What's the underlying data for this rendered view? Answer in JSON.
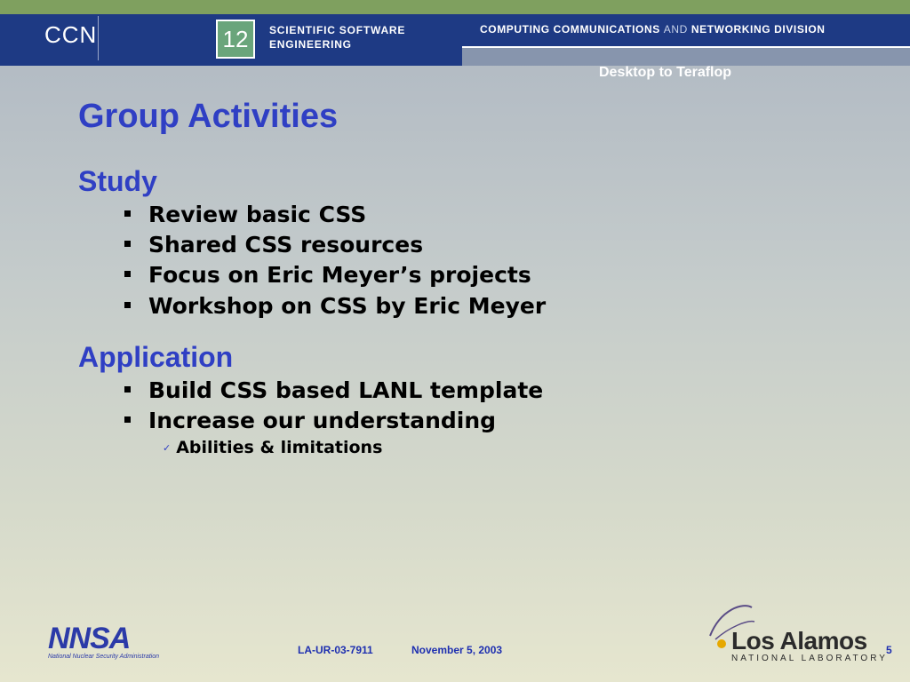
{
  "header": {
    "ccn_logo": "CCN",
    "logo_12": "12",
    "group_name_line1": "SCIENTIFIC SOFTWARE",
    "group_name_line2": "ENGINEERING",
    "division_part1": "COMPUTING COMMUNICATIONS ",
    "division_and": "AND",
    "division_part2": " NETWORKING DIVISION",
    "tagline": "Desktop to Teraflop"
  },
  "slide": {
    "title": "Group Activities",
    "sections": [
      {
        "heading": "Study",
        "bullets": [
          "Review basic CSS",
          "Shared CSS resources",
          "Focus on Eric Meyer’s projects",
          "Workshop on CSS by Eric Meyer"
        ]
      },
      {
        "heading": "Application",
        "bullets": [
          "Build CSS based LANL template",
          "Increase our understanding"
        ],
        "sub_bullet": "Abilities & limitations"
      }
    ]
  },
  "footer": {
    "doc_id": "LA-UR-03-7911",
    "date": "November  5, 2003",
    "page_number": "5",
    "nnsa_logo": "NNSA",
    "nnsa_text": "National Nuclear Security Administration",
    "lanl_name": "Los Alamos",
    "lanl_sub": "NATIONAL LABORATORY"
  },
  "colors": {
    "header_blue": "#1e3a84",
    "accent_green": "#7fa05f",
    "heading_blue": "#2f3fc4",
    "footer_blue": "#1e2fb0"
  },
  "icons": [
    "square-bullet-icon",
    "checkmark-icon",
    "nnsa-logo",
    "los-alamos-logo"
  ]
}
